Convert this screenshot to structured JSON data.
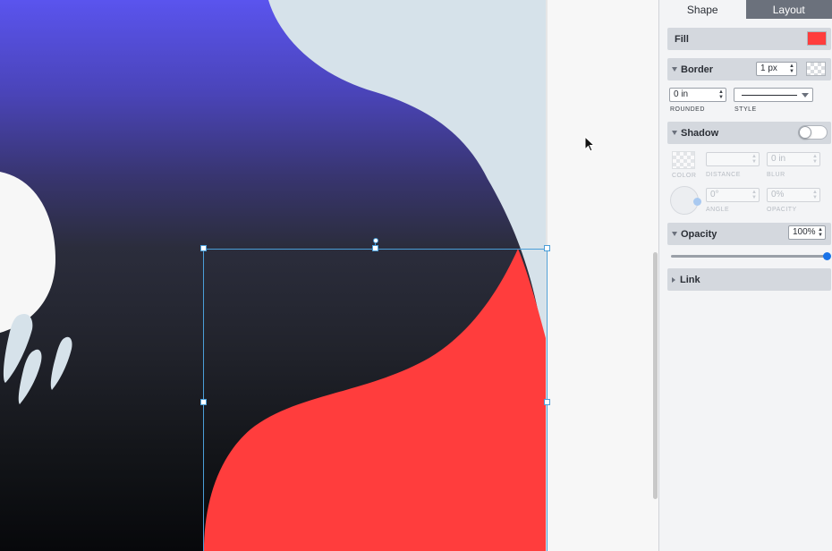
{
  "panel": {
    "tabs": [
      {
        "label": "Shape",
        "active": true
      },
      {
        "label": "Layout",
        "active": false
      }
    ],
    "fill": {
      "label": "Fill",
      "color": "#ff3d3d"
    },
    "border": {
      "label": "Border",
      "width": "1 px",
      "rounded": {
        "value": "0 in",
        "label": "ROUNDED"
      },
      "style": {
        "label": "STYLE"
      }
    },
    "shadow": {
      "label": "Shadow",
      "enabled": false,
      "color": {
        "label": "COLOR"
      },
      "distance": {
        "value": "",
        "label": "DISTANCE"
      },
      "blur": {
        "value": "0 in",
        "label": "BLUR"
      },
      "angle": {
        "value": "0°",
        "label": "ANGLE"
      },
      "opacity": {
        "value": "0%",
        "label": "OPACITY"
      }
    },
    "opacity": {
      "label": "Opacity",
      "value": "100%",
      "level": 1.0
    },
    "link": {
      "label": "Link"
    }
  },
  "canvas": {
    "colors": {
      "sky_top": "#5a54ee",
      "sky_mid": "#3b3578",
      "sky_dark": "#272a35",
      "sky_bottom": "#080a0d",
      "light_shape": "#d6e2ea",
      "moon": "#f7f7f7",
      "red_shape": "#ff3d3d",
      "selection": "#4a9ed8"
    }
  }
}
